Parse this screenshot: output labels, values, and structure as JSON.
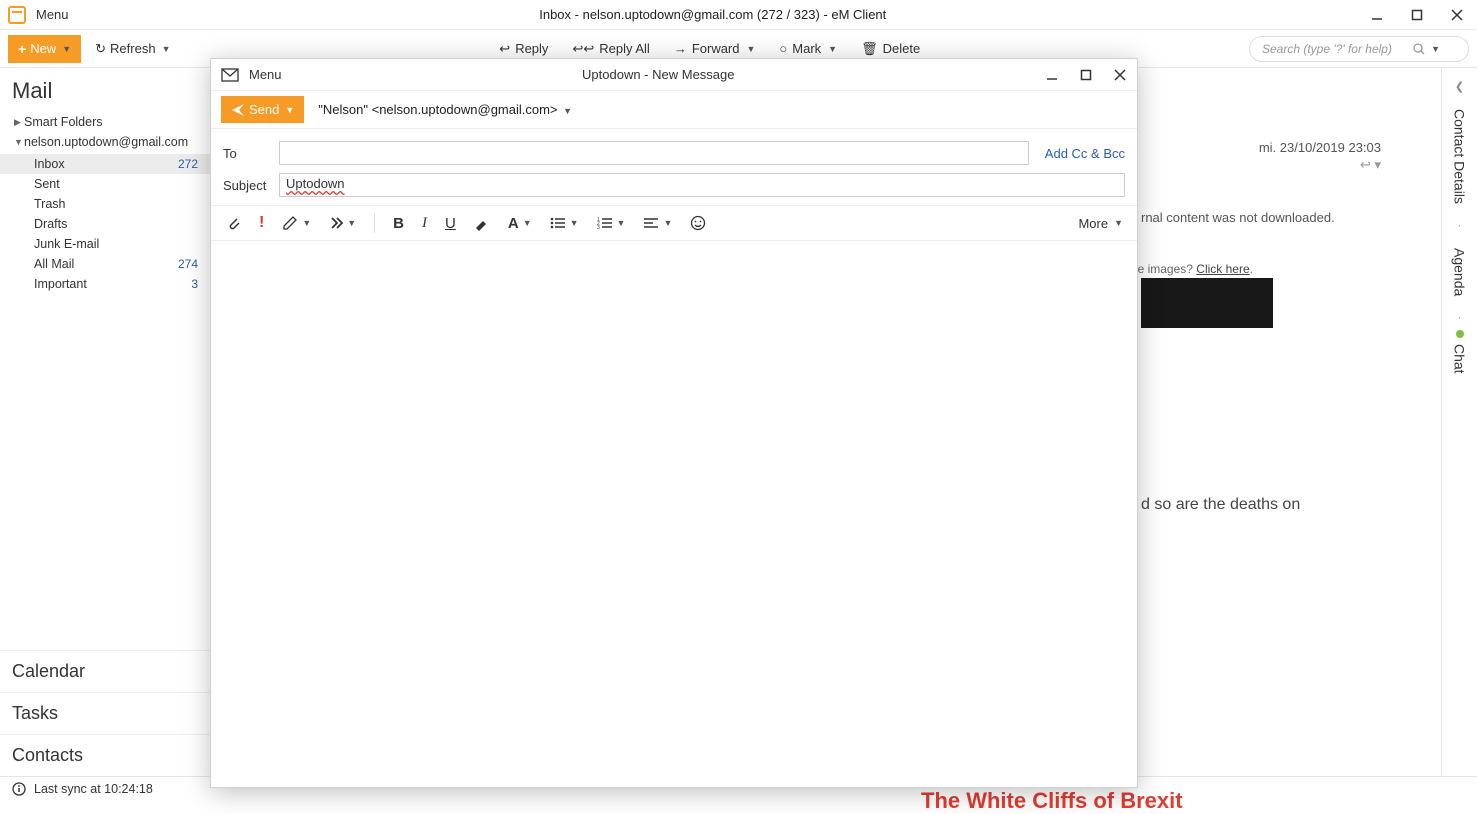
{
  "titlebar": {
    "menu_label": "Menu",
    "title": "Inbox - nelson.uptodown@gmail.com (272 / 323) - eM Client"
  },
  "toolbar": {
    "new_label": "New",
    "refresh_label": "Refresh",
    "reply_label": "Reply",
    "reply_all_label": "Reply All",
    "forward_label": "Forward",
    "mark_label": "Mark",
    "delete_label": "Delete"
  },
  "search": {
    "placeholder": "Search (type '?' for help)"
  },
  "sidebar": {
    "mail_header": "Mail",
    "smart_folders": "Smart Folders",
    "account": "nelson.uptodown@gmail.com",
    "folders": [
      {
        "name": "Inbox",
        "count": "272",
        "selected": true
      },
      {
        "name": "Sent",
        "count": "",
        "selected": false
      },
      {
        "name": "Trash",
        "count": "",
        "selected": false
      },
      {
        "name": "Drafts",
        "count": "",
        "selected": false
      },
      {
        "name": "Junk E-mail",
        "count": "",
        "selected": false
      },
      {
        "name": "All Mail",
        "count": "274",
        "selected": false
      },
      {
        "name": "Important",
        "count": "3",
        "selected": false
      }
    ],
    "calendar": "Calendar",
    "tasks": "Tasks",
    "contacts": "Contacts"
  },
  "status": {
    "last_sync": "Last sync at 10:24:18"
  },
  "rightbar": {
    "contact_details": "Contact Details",
    "agenda": "Agenda",
    "chat": "Chat"
  },
  "preview": {
    "date": "mi. 23/10/2019 23:03",
    "external_warn": "rnal content was not downloaded.",
    "cant_see": "Can't see images? ",
    "click_here": "Click here",
    "big_text": "d so are the deaths on",
    "brexit": "The White Cliffs of Brexit"
  },
  "compose": {
    "menu_label": "Menu",
    "title": "Uptodown - New Message",
    "send_label": "Send",
    "from": "\"Nelson\" <nelson.uptodown@gmail.com>",
    "to_label": "To",
    "subject_label": "Subject",
    "subject_value": "Uptodown",
    "addcc_label": "Add Cc & Bcc",
    "more_label": "More"
  }
}
